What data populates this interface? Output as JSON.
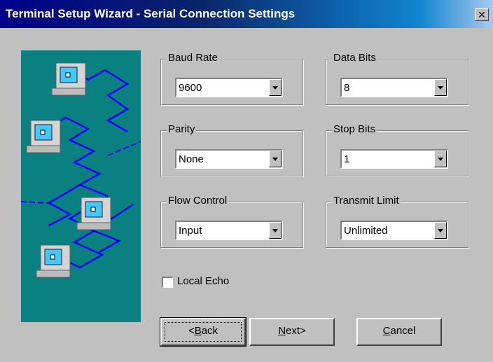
{
  "window": {
    "title": "Terminal Setup Wizard - Serial Connection Settings",
    "close_glyph": "✕"
  },
  "groups": {
    "baud_rate": {
      "label": "Baud Rate",
      "value": "9600"
    },
    "data_bits": {
      "label": "Data Bits",
      "value": "8"
    },
    "parity": {
      "label": "Parity",
      "value": "None"
    },
    "stop_bits": {
      "label": "Stop Bits",
      "value": "1"
    },
    "flow_control": {
      "label": "Flow Control",
      "value": "Input"
    },
    "transmit_limit": {
      "label": "Transmit Limit",
      "value": "Unlimited"
    }
  },
  "local_echo": {
    "label": "Local Echo",
    "checked": false
  },
  "buttons": {
    "back": {
      "pre": "<",
      "mnemonic": "B",
      "post": "ack"
    },
    "next": {
      "pre": "",
      "mnemonic": "N",
      "post": "ext>"
    },
    "cancel": {
      "pre": "",
      "mnemonic": "C",
      "post": "ancel"
    }
  },
  "colors": {
    "illustration_bg": "#0a8080",
    "network_line": "#0000ff",
    "dialog_bg": "#c0c0c0"
  }
}
